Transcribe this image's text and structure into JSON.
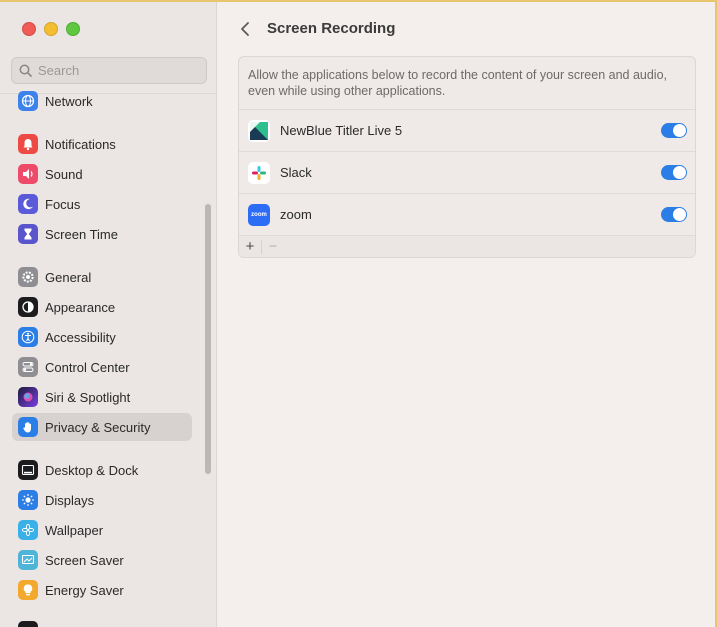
{
  "search": {
    "placeholder": "Search"
  },
  "sidebar": {
    "items": [
      {
        "label": "Network",
        "icon": "globe-icon",
        "color": "#3d82ea"
      },
      {
        "label": "Notifications",
        "icon": "bell-icon",
        "color": "#ee4a45"
      },
      {
        "label": "Sound",
        "icon": "speaker-icon",
        "color": "#ee4a6a"
      },
      {
        "label": "Focus",
        "icon": "moon-icon",
        "color": "#5b5bd9"
      },
      {
        "label": "Screen Time",
        "icon": "hourglass-icon",
        "color": "#5a55cc"
      },
      {
        "label": "General",
        "icon": "gear-icon",
        "color": "#8e8e93"
      },
      {
        "label": "Appearance",
        "icon": "appearance-icon",
        "color": "#1c1c1e"
      },
      {
        "label": "Accessibility",
        "icon": "accessibility-icon",
        "color": "#2a7ee6"
      },
      {
        "label": "Control Center",
        "icon": "toggles-icon",
        "color": "#8e8e93"
      },
      {
        "label": "Siri & Spotlight",
        "icon": "siri-icon",
        "color": "#7b3fe4"
      },
      {
        "label": "Privacy & Security",
        "icon": "hand-icon",
        "color": "#2a7ee6"
      },
      {
        "label": "Desktop & Dock",
        "icon": "dock-icon",
        "color": "#1c1c1e"
      },
      {
        "label": "Displays",
        "icon": "sun-icon",
        "color": "#2a7ee6"
      },
      {
        "label": "Wallpaper",
        "icon": "flower-icon",
        "color": "#3ab0e8"
      },
      {
        "label": "Screen Saver",
        "icon": "screensaver-icon",
        "color": "#4fb5d8"
      },
      {
        "label": "Energy Saver",
        "icon": "bulb-icon",
        "color": "#f3a92d"
      }
    ],
    "selected": "Privacy & Security"
  },
  "main": {
    "title": "Screen Recording",
    "description": "Allow the applications below to record the content of your screen and audio, even while using other applications.",
    "apps": [
      {
        "name": "NewBlue Titler Live 5",
        "icon": "newblue-app-icon",
        "enabled": true
      },
      {
        "name": "Slack",
        "icon": "slack-app-icon",
        "enabled": true
      },
      {
        "name": "zoom",
        "icon": "zoom-app-icon",
        "icon_text": "zoom",
        "enabled": true
      }
    ],
    "footer": {
      "add": "+",
      "remove": "−"
    }
  },
  "colors": {
    "accent": "#2a7ee6",
    "selected_bg": "#d7d1cf"
  }
}
